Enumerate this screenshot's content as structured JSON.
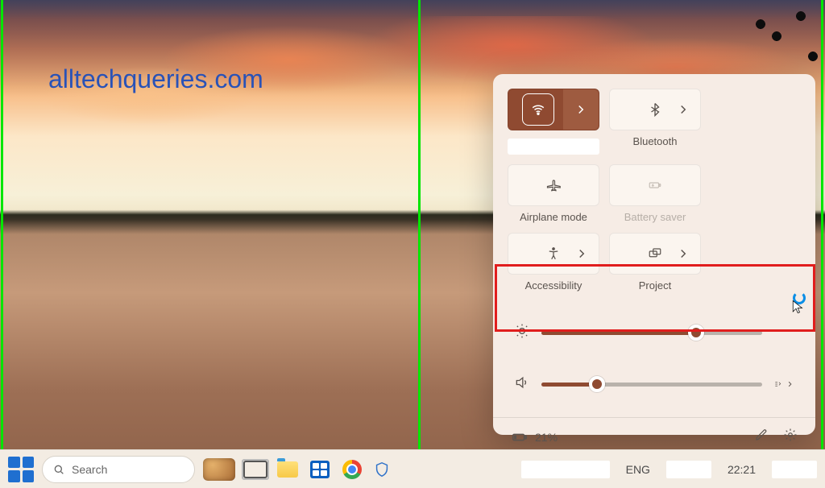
{
  "watermark": "alltechqueries.com",
  "quick_settings": {
    "tiles": [
      {
        "id": "wifi",
        "icon": "wifi-icon",
        "label": "",
        "active": true,
        "has_chevron": true,
        "label_placeholder": true
      },
      {
        "id": "bluetooth",
        "icon": "bluetooth-icon",
        "label": "Bluetooth",
        "active": false,
        "has_chevron": true
      },
      {
        "id": "airplane",
        "icon": "airplane-icon",
        "label": "Airplane mode",
        "active": false,
        "has_chevron": false
      },
      {
        "id": "battery-saver",
        "icon": "battery-saver-icon",
        "label": "Battery saver",
        "active": false,
        "has_chevron": false,
        "dim": true
      },
      {
        "id": "accessibility",
        "icon": "accessibility-icon",
        "label": "Accessibility",
        "active": false,
        "has_chevron": true
      },
      {
        "id": "project",
        "icon": "project-icon",
        "label": "Project",
        "active": false,
        "has_chevron": true
      }
    ],
    "brightness_percent": 70,
    "volume_percent": 25,
    "battery_text": "21%"
  },
  "taskbar": {
    "search_placeholder": "Search",
    "language": "ENG",
    "time": "22:21"
  },
  "annotations": {
    "outer_green": true,
    "vertical_green_divider": true,
    "highlight_brightness_slider": true
  }
}
